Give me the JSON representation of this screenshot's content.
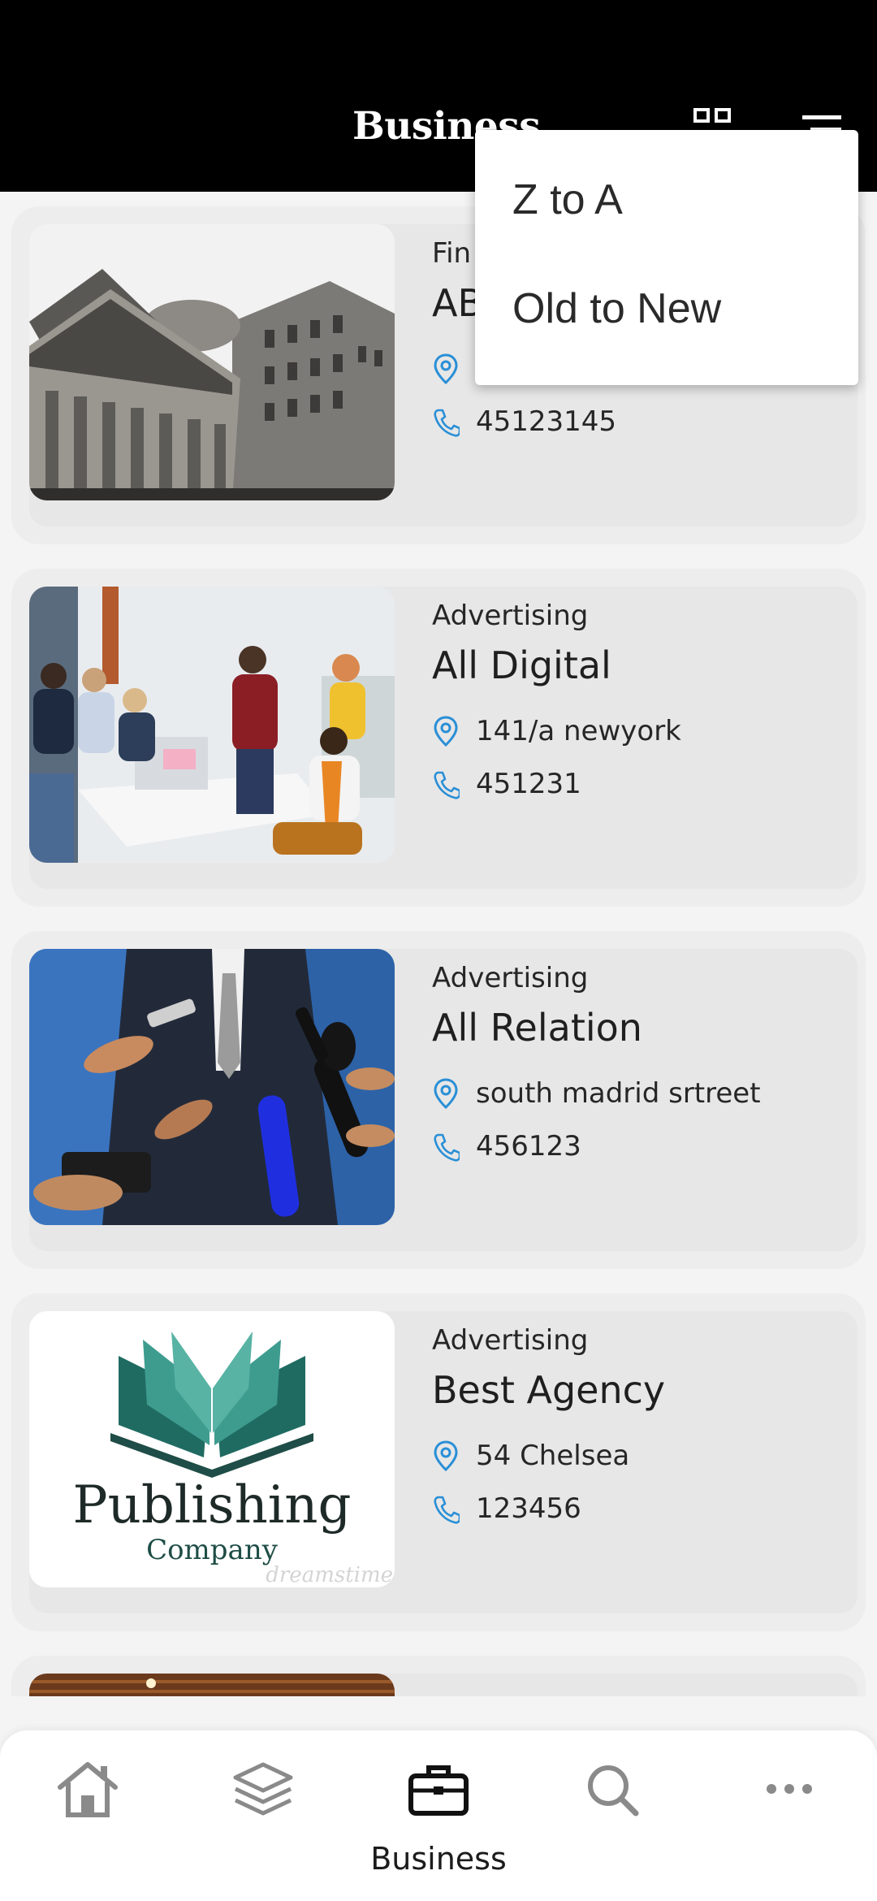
{
  "header": {
    "title": "Business",
    "icons": [
      "grid-view-icon",
      "sort-menu-icon"
    ]
  },
  "sort_menu": {
    "items": [
      "Z to A",
      "Old to New"
    ]
  },
  "businesses": [
    {
      "category": "Fin",
      "name": "AB",
      "address": "",
      "phone": "45123145",
      "image": "bank-building"
    },
    {
      "category": "Advertising",
      "name": "All Digital",
      "address": "141/a newyork",
      "phone": "451231",
      "image": "office-team"
    },
    {
      "category": "Advertising",
      "name": "All Relation",
      "address": "south madrid srtreet",
      "phone": "456123",
      "image": "press-microphones"
    },
    {
      "category": "Advertising",
      "name": "Best Agency",
      "address": "54 Chelsea",
      "phone": "123456",
      "image": "publishing-logo",
      "logo_text": {
        "line1": "Publishing",
        "line2": "Company",
        "watermark": "dreamstime"
      }
    }
  ],
  "bottom_nav": {
    "items": [
      {
        "icon": "home-icon",
        "label": ""
      },
      {
        "icon": "layers-icon",
        "label": ""
      },
      {
        "icon": "briefcase-icon",
        "label": "Business",
        "active": true
      },
      {
        "icon": "search-icon",
        "label": ""
      },
      {
        "icon": "more-icon",
        "label": ""
      }
    ]
  },
  "colors": {
    "header_bg": "#000000",
    "accent_icon": "#2a8fd6",
    "card_bg": "#ededed",
    "page_bg": "#f4f4f4"
  }
}
